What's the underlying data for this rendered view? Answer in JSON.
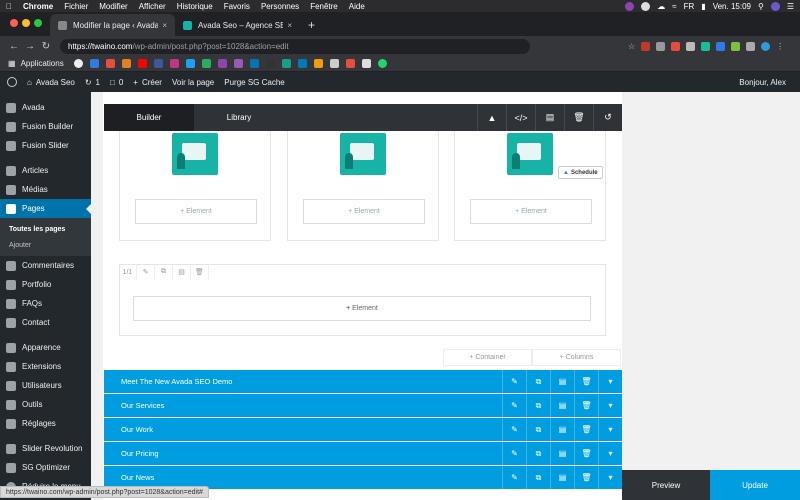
{
  "mac_menu": {
    "app": "Chrome",
    "items": [
      "Fichier",
      "Modifier",
      "Afficher",
      "Historique",
      "Favoris",
      "Personnes",
      "Fenêtre",
      "Aide"
    ],
    "language": "FR",
    "clock": "Ven. 15:09"
  },
  "browser": {
    "tabs": [
      {
        "title": "Modifier la page ‹ Avada Seo —",
        "active": true
      },
      {
        "title": "Avada Seo – Agence SEO",
        "active": false
      }
    ],
    "url_host": "https://twaino.com",
    "url_path": "/wp-admin/post.php?post=1028&action=edit",
    "bookmarks_label": "Applications",
    "status_url": "https://twaino.com/wp-admin/post.php?post=1028&action=edit#"
  },
  "wp_adminbar": {
    "site": "Avada Seo",
    "updates": "1",
    "comments": "0",
    "new": "Créer",
    "view": "Voir la page",
    "purge": "Purge SG Cache",
    "greeting": "Bonjour, Alex"
  },
  "sidebar": {
    "items": [
      {
        "label": "Avada"
      },
      {
        "label": "Fusion Builder"
      },
      {
        "label": "Fusion Slider"
      },
      {
        "label": "Articles"
      },
      {
        "label": "Médias"
      },
      {
        "label": "Pages"
      },
      {
        "label": "Commentaires"
      },
      {
        "label": "Portfolio"
      },
      {
        "label": "FAQs"
      },
      {
        "label": "Contact"
      },
      {
        "label": "Apparence"
      },
      {
        "label": "Extensions"
      },
      {
        "label": "Utilisateurs"
      },
      {
        "label": "Outils"
      },
      {
        "label": "Réglages"
      },
      {
        "label": "Slider Revolution"
      },
      {
        "label": "SG Optimizer"
      },
      {
        "label": "Réduire le menu"
      }
    ],
    "submenu": [
      "Toutes les pages",
      "Ajouter"
    ]
  },
  "builder": {
    "tab_builder": "Builder",
    "tab_library": "Library",
    "element_label": "Element",
    "schedule_label": "Schedule",
    "column_ratio": "1/1",
    "container_label": "Container",
    "columns_label": "Columns",
    "containers": [
      "Meet The New Avada SEO Demo",
      "Our Services",
      "Our Work",
      "Our Pricing",
      "Our News"
    ]
  },
  "footer": {
    "preview": "Preview",
    "update": "Update"
  },
  "colors": {
    "accent": "#009ee0",
    "wp_dark": "#23282d",
    "wp_blue": "#0073aa"
  }
}
